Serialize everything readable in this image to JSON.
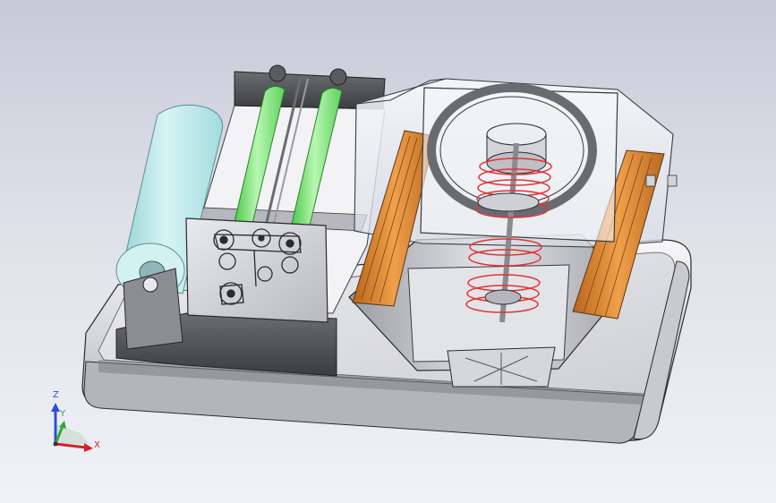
{
  "triad": {
    "z_label": "Z",
    "y_label": "Y",
    "x_label": "X",
    "colors": {
      "z": "#2a4fd6",
      "y": "#2faa33",
      "x": "#d42222"
    }
  },
  "palette": {
    "roller_green": "#7ee87a",
    "paper_roll": "#bfe9ea",
    "coil_red": "#e23333",
    "heater_orange": "#d9822b",
    "tray_gray": "#8f9094",
    "frame_dark": "#4a4b4f",
    "acrylic": "#eef1f6"
  }
}
